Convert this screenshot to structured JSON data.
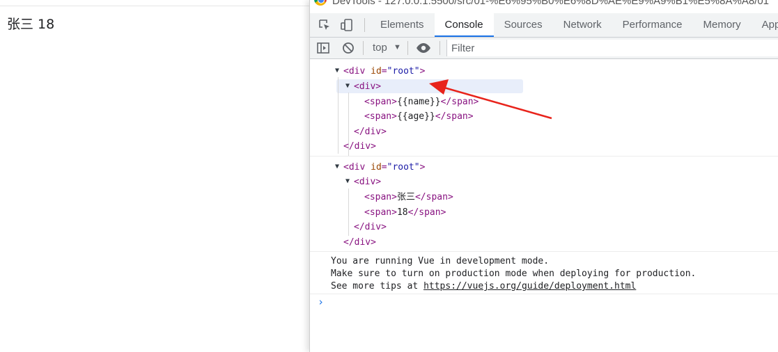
{
  "page": {
    "name": "张三",
    "age": "18"
  },
  "devtools": {
    "window_title": "DevTools - 127.0.0.1:5500/src/01-%E6%95%B0%E6%8D%AE%E9%A9%B1%E5%8A%A8/01",
    "tabs": [
      "Elements",
      "Console",
      "Sources",
      "Network",
      "Performance",
      "Memory",
      "Appli"
    ],
    "active_tab": "Console",
    "context": "top",
    "filter_placeholder": "Filter",
    "accent_color": "#1a73e8",
    "annotation_color": "#e8231b"
  },
  "console": {
    "dom1": {
      "root_open": "<div id=\"root\">",
      "root_tag": "<div",
      "root_attr": "id",
      "root_val": "\"root\"",
      "div_open": "<div>",
      "span1": "{{name}}",
      "span2": "{{age}}",
      "span_open": "<span>",
      "span_close": "</span>",
      "div_close": "</div>"
    },
    "dom2": {
      "span1": "张三",
      "span2": "18"
    },
    "messages": [
      "You are running Vue in development mode.",
      "Make sure to turn on production mode when deploying for production.",
      "See more tips at "
    ],
    "link": "https://vuejs.org/guide/deployment.html",
    "prompt": "›"
  }
}
